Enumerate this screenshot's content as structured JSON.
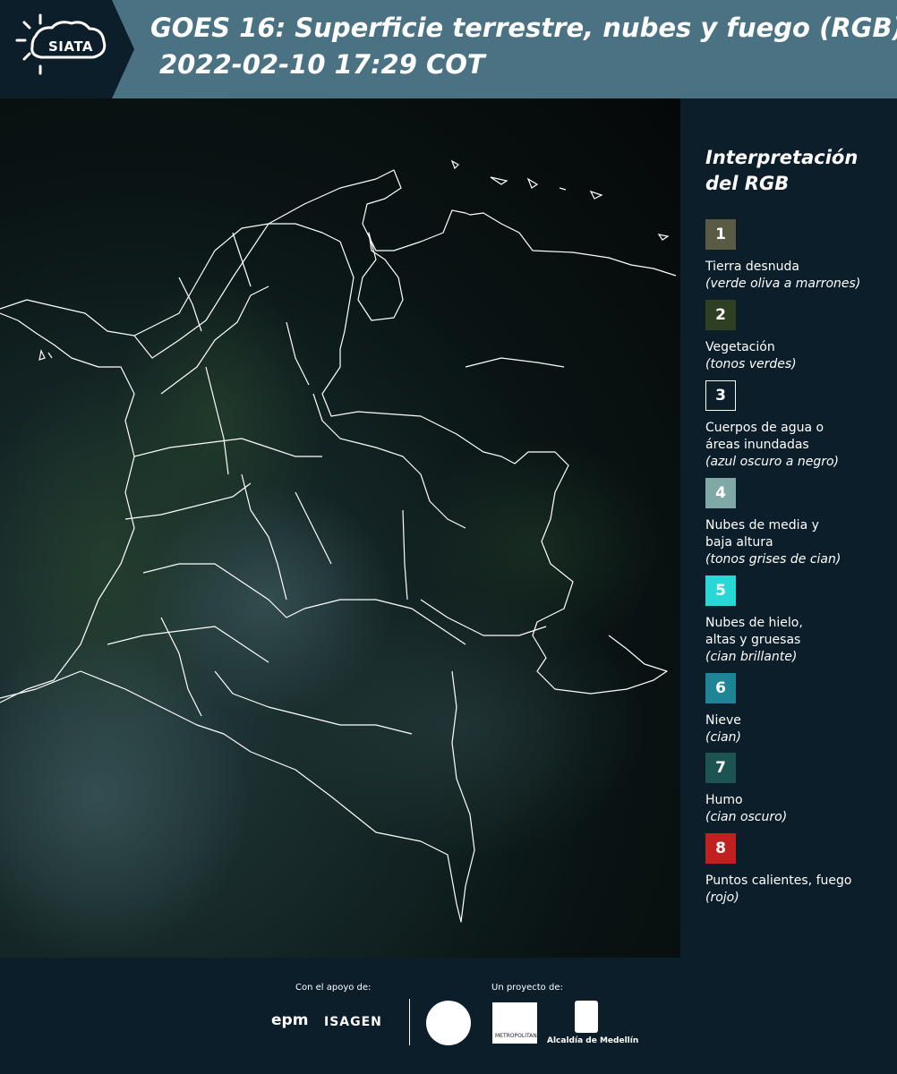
{
  "header": {
    "logo_text": "SIATA",
    "title": "GOES 16: Superficie terrestre, nubes y fuego (RGB)",
    "subtitle": "2022-02-10 17:29 COT"
  },
  "legend": {
    "title_line1": "Interpretación",
    "title_line2": "del RGB",
    "items": [
      {
        "number": "1",
        "color": "#5a5a45",
        "label": "Tierra desnuda",
        "desc": "(verde oliva a marrones)"
      },
      {
        "number": "2",
        "color": "#2e3f22",
        "label": "Vegetación",
        "desc": "(tonos verdes)"
      },
      {
        "number": "3",
        "color": "#0c1e2a",
        "label": "Cuerpos de agua o\náreas inundadas",
        "desc": "(azul oscuro a negro)"
      },
      {
        "number": "4",
        "color": "#7fa9a6",
        "label": "Nubes de media y\nbaja altura",
        "desc": "(tonos grises de cian)"
      },
      {
        "number": "5",
        "color": "#29d8d6",
        "label": "Nubes de hielo,\naltas y gruesas",
        "desc": "(cian brillante)"
      },
      {
        "number": "6",
        "color": "#1f8496",
        "label": "Nieve",
        "desc": "(cian)"
      },
      {
        "number": "7",
        "color": "#1d5451",
        "label": "Humo",
        "desc": "(cian oscuro)"
      },
      {
        "number": "8",
        "color": "#c0201f",
        "label": "Puntos calientes, fuego",
        "desc": "(rojo)"
      }
    ]
  },
  "footer": {
    "support_label": "Con el apoyo de:",
    "project_label": "Un proyecto de:",
    "epm": "epm",
    "isagen": "ISAGEN",
    "area_text": "METROPOLITANA",
    "alcaldia": "Alcaldía de Medellín"
  }
}
